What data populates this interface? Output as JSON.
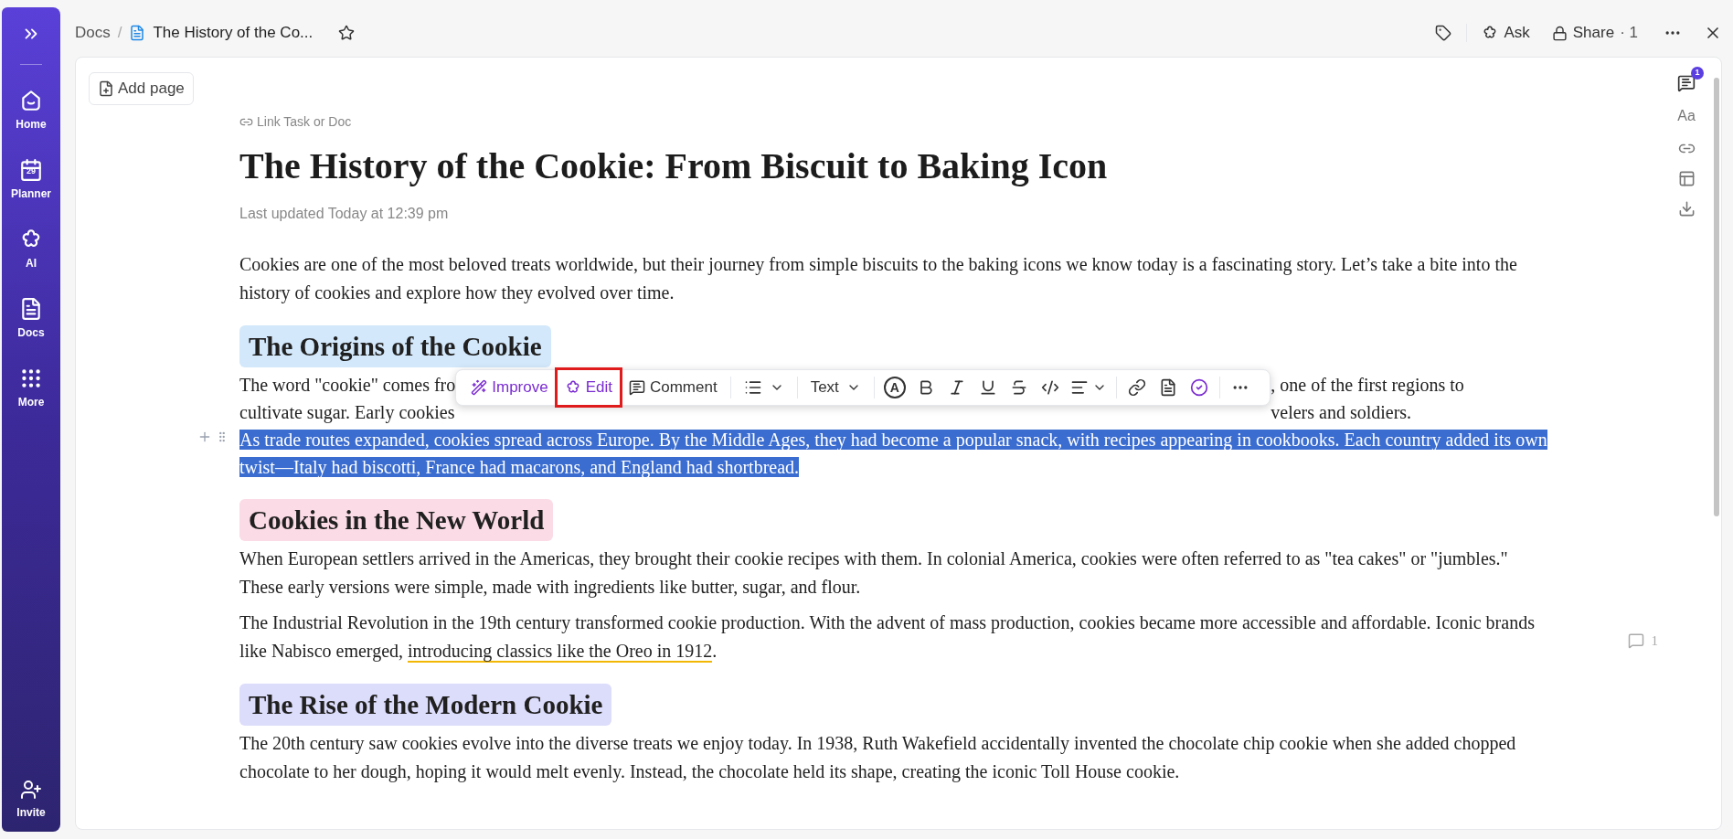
{
  "sidebar": {
    "items": [
      {
        "kind": "home",
        "label": "Home"
      },
      {
        "kind": "planner",
        "label": "Planner",
        "day": "29"
      },
      {
        "kind": "ai",
        "label": "AI"
      },
      {
        "kind": "docs",
        "label": "Docs"
      },
      {
        "kind": "more",
        "label": "More"
      }
    ],
    "footer": {
      "label": "Invite"
    }
  },
  "breadcrumb": {
    "root": "Docs",
    "separator": "/",
    "current": "The History of the Co..."
  },
  "top_actions": {
    "ask": "Ask",
    "share": "Share",
    "share_count": "· 1"
  },
  "add_page": "Add page",
  "link_task": "Link Task or Doc",
  "title": "The History of the Cookie: From Biscuit to Baking Icon",
  "updated": "Last updated Today at 12:39 pm",
  "right_rail": {
    "comment_count": "1",
    "font_label": "Aa"
  },
  "blocks": [
    {
      "kind": "paragraph",
      "text": "Cookies are one of the most beloved treats worldwide, but their journey from simple biscuits to the baking icons we know today is a fascinating story. Let’s take a bite into the history of cookies and explore how they evolved over time."
    },
    {
      "kind": "heading",
      "text": "The Origins of the Cookie",
      "color": "#d3e8fb"
    },
    {
      "kind": "covered",
      "rows": [
        {
          "left": "The word \"cookie\" comes fro",
          "right": ", one of the first regions to"
        },
        {
          "left": "cultivate sugar. Early cookies",
          "right": "velers and soldiers."
        }
      ]
    },
    {
      "kind": "paragraph",
      "selected": true,
      "text": "As trade routes expanded, cookies spread across Europe. By the Middle Ages, they had become a popular snack, with recipes appearing in cookbooks. Each country added its own twist—Italy had biscotti, France had macarons, and England had shortbread."
    },
    {
      "kind": "heading",
      "text": "Cookies in the New World",
      "color": "#fbdbe6"
    },
    {
      "kind": "paragraph",
      "text": "When European settlers arrived in the Americas, they brought their cookie recipes with them. In colonial America, cookies were often referred to as \"tea cakes\" or \"jumbles.\" These early versions were simple, made with ingredients like butter, sugar, and flour."
    },
    {
      "kind": "commented",
      "before": "The Industrial Revolution in the 19th century transformed cookie production. With the advent of mass production, cookies became more accessible and affordable. Iconic brands like Nabisco emerged, ",
      "marked": "introducing classics like the Oreo in 1912",
      "after": ".",
      "comment_count": "1"
    },
    {
      "kind": "heading",
      "text": "The Rise of the Modern Cookie",
      "color": "#dcdcfb"
    },
    {
      "kind": "paragraph",
      "text": "The 20th century saw cookies evolve into the diverse treats we enjoy today. In 1938, Ruth Wakefield accidentally invented the chocolate chip cookie when she added chopped chocolate to her dough, hoping it would melt evenly. Instead, the chocolate held its shape, creating the iconic Toll House cookie."
    }
  ],
  "toolbar": {
    "buttons": [
      {
        "kind": "improve",
        "label": "Improve",
        "highlighted": false
      },
      {
        "kind": "edit",
        "label": "Edit",
        "highlighted": true
      },
      {
        "kind": "comment",
        "label": "Comment",
        "highlighted": false
      }
    ],
    "text_style": "Text",
    "color_letter": "A"
  }
}
